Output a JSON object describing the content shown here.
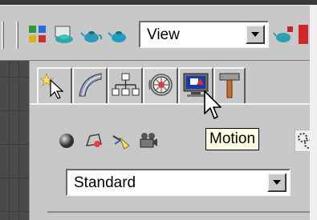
{
  "toolbar": {
    "icons": [
      "layers-icon",
      "render-setup-icon",
      "teapot-render-icon",
      "teapot-quick-render-icon",
      "render-frame-icon"
    ],
    "view_dropdown": {
      "value": "View"
    }
  },
  "command_panel": {
    "tabs": [
      "create-tab",
      "modify-tab",
      "hierarchy-tab",
      "motion-tab",
      "display-tab",
      "utilities-tab"
    ],
    "active_tab": "motion-tab",
    "sub_icons": [
      "geometry-icon",
      "shapes-icon",
      "lights-icon",
      "cameras-icon",
      "helpers-icon",
      "systems-icon"
    ],
    "category_dropdown": {
      "value": "Standard"
    }
  },
  "tooltip": {
    "text": "Motion"
  },
  "colors": {
    "panel_bg": "#c8c8c8",
    "tooltip_bg": "#ffffe1",
    "viewport_bg": "#4a4a4a"
  }
}
